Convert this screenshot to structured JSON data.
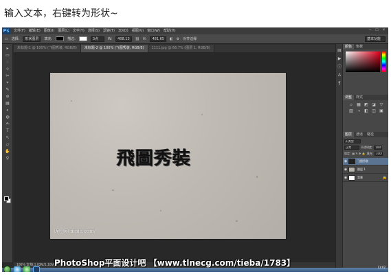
{
  "caption": "输入文本，右键转为形状~",
  "app": {
    "logo": "Ps",
    "menu": [
      "文件(F)",
      "编辑(E)",
      "图像(I)",
      "图层(L)",
      "文字(Y)",
      "选择(S)",
      "滤镜(T)",
      "3D(D)",
      "视图(V)",
      "窗口(W)",
      "帮助(H)"
    ],
    "window_buttons": [
      "–",
      "□",
      "×"
    ]
  },
  "options_bar": {
    "mode_label": "选择:",
    "mode_value": "形状图层",
    "fill_label": "填充:",
    "stroke_label": "描边:",
    "stroke_width": "3点",
    "w_label": "W:",
    "w_value": "408.13",
    "h_label": "H:",
    "h_value": "481.65",
    "align_edges": "对齐边缘",
    "workspace": "基本功能"
  },
  "doc_tabs": [
    {
      "label": "未标题-1 @ 100% (飞图秀装, RGB/8)",
      "active": false
    },
    {
      "label": "未标题-2 @ 100% (飞图秀装, RGB/8)",
      "active": true
    },
    {
      "label": "1111.jpg @ 66.7% (图层 1, RGB/8)",
      "active": false
    }
  ],
  "tools": [
    "▸",
    "▭",
    "◌",
    "⊹",
    "✂",
    "⌖",
    "✎",
    "⊘",
    "▤",
    "◐",
    "◍",
    "✍",
    "T",
    "↖",
    "▱",
    "✋",
    "⚲"
  ],
  "canvas": {
    "art_text": "飛圖秀裝",
    "watermark": "昵图网 nipic.com/"
  },
  "status_bar": "100%   文档:1.03M/1.10M",
  "panels": {
    "color_tabs": [
      "颜色",
      "色板"
    ],
    "adjustments_tabs": [
      "调整",
      "样式"
    ],
    "adjust_icons": [
      "☼",
      "▦",
      "◩",
      "◪",
      "▽",
      "▥",
      "◑",
      "◧",
      "◫",
      "▣"
    ],
    "layer_tabs": [
      "图层",
      "通道",
      "路径"
    ],
    "kind_label": "ρ 类型",
    "blend_mode": "正常",
    "opacity_label": "不透明度:",
    "opacity_value": "100%",
    "lock_label": "锁定:",
    "fill_label": "填充:",
    "fill_value": "100%",
    "layers": [
      {
        "name": "飞图秀装",
        "selected": true,
        "thumb": "#222222"
      },
      {
        "name": "图层 1",
        "selected": false,
        "thumb": "#b9b4ad"
      },
      {
        "name": "背景",
        "selected": false,
        "thumb": "#ffffff"
      }
    ]
  },
  "banner": "PhotoShop平面设计吧 【www.tlnecg.com/tieba/1783】",
  "taskbar": {
    "clock_time": "13:02",
    "clock_date": "2013/8/17"
  }
}
